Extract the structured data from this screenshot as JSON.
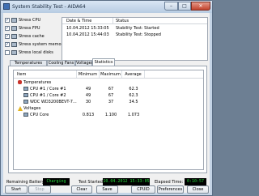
{
  "window": {
    "title": "System Stability Test - AIDA64",
    "min_glyph": "–",
    "max_glyph": "□",
    "close_glyph": "✕"
  },
  "stress_options": [
    {
      "label": "Stress CPU",
      "checked": true
    },
    {
      "label": "Stress FPU",
      "checked": true
    },
    {
      "label": "Stress cache",
      "checked": true
    },
    {
      "label": "Stress system memory",
      "checked": true
    },
    {
      "label": "Stress local disks",
      "checked": false
    }
  ],
  "log": {
    "headers": {
      "date": "Date & Time",
      "status": "Status"
    },
    "rows": [
      {
        "date": "10.04.2012 15:33:05",
        "status": "Stability Test: Started"
      },
      {
        "date": "10.04.2012 15:44:03",
        "status": "Stability Test: Stopped"
      }
    ]
  },
  "tabs": [
    {
      "label": "Temperatures",
      "active": false
    },
    {
      "label": "Cooling Fans",
      "active": false
    },
    {
      "label": "Voltages",
      "active": false
    },
    {
      "label": "Statistics",
      "active": true
    }
  ],
  "stats": {
    "headers": {
      "item": "Item",
      "min": "Minimum",
      "max": "Maximum",
      "avg": "Average"
    },
    "groups": [
      {
        "name": "Temperatures",
        "icon": "thermometer-icon",
        "items": [
          {
            "name": "CPU #1 / Core #1",
            "min": "49",
            "max": "67",
            "avg": "62.3"
          },
          {
            "name": "CPU #1 / Core #2",
            "min": "49",
            "max": "67",
            "avg": "62.3"
          },
          {
            "name": "WDC WD3200BEVT-7...",
            "min": "30",
            "max": "37",
            "avg": "34.5"
          }
        ]
      },
      {
        "name": "Voltages",
        "icon": "voltage-warning-icon",
        "items": [
          {
            "name": "CPU Core",
            "min": "0.813",
            "max": "1.100",
            "avg": "1.073"
          }
        ]
      }
    ]
  },
  "status": {
    "battery_label": "Remaining Battery:",
    "battery_value": "Charging",
    "started_label": "Test Started:",
    "started_value": "10.04.2012 15:33:05",
    "elapsed_label": "Elapsed Time:",
    "elapsed_value": "0:10:57",
    "value_color": "#25d63a"
  },
  "buttons": {
    "start": "Start",
    "stop": "Stop",
    "clear": "Clear",
    "save": "Save",
    "cpuid": "CPUID",
    "preferences": "Preferences",
    "close": "Close"
  }
}
